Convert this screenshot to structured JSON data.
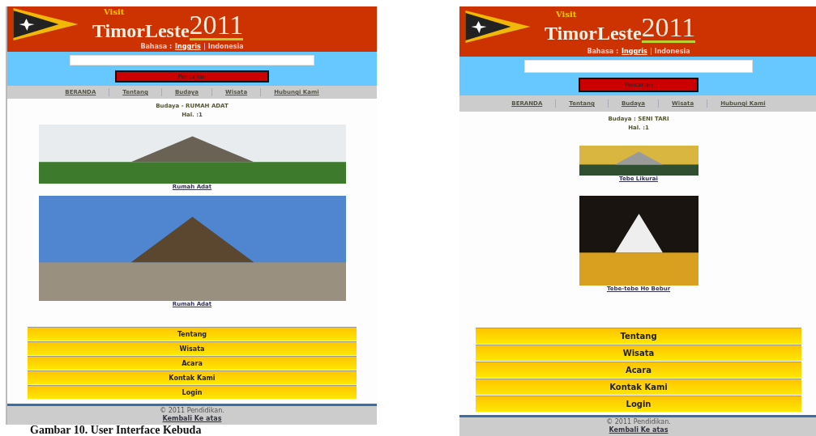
{
  "screens": [
    {
      "logo": {
        "small": "Visit",
        "name": "TimorLeste",
        "year": "2011"
      },
      "language_label": "Bahasa :",
      "languages": [
        {
          "label": "Inggris",
          "selected": false
        },
        {
          "label": "Indonesia",
          "selected": true
        }
      ],
      "search": {
        "button": "Pencarian"
      },
      "nav": [
        "BERANDA",
        "Tentang",
        "Budaya",
        "Wisata",
        "Hubungi Kami"
      ],
      "heading": "Budaya - RUMAH ADAT",
      "page": "Hal. :1",
      "photos": [
        {
          "caption": "Rumah Adat"
        },
        {
          "caption": "Rumah Adat"
        }
      ],
      "menu": [
        "Tentang",
        "Wisata",
        "Acara",
        "Kontak Kami",
        "Login"
      ],
      "footer": {
        "copyright": "© 2011 Pendidikan.",
        "link": "Kembali Ke atas"
      }
    },
    {
      "logo": {
        "small": "Visit",
        "name": "TimorLeste",
        "year": "2011"
      },
      "language_label": "Bahasa :",
      "languages": [
        {
          "label": "Inggris",
          "selected": false
        },
        {
          "label": "Indonesia",
          "selected": true
        }
      ],
      "search": {
        "button": "Pencarian"
      },
      "nav": [
        "BERANDA",
        "Tentang",
        "Budaya",
        "Wisata",
        "Hubungi Kami"
      ],
      "heading": "Budaya : SENI TARI",
      "page": "Hal. :1",
      "photos": [
        {
          "caption": "Tebe Likurai"
        },
        {
          "caption": "Tebe-tebe Ho Bebur"
        }
      ],
      "menu": [
        "Tentang",
        "Wisata",
        "Acara",
        "Kontak Kami",
        "Login"
      ],
      "footer": {
        "copyright": "© 2011 Pendidikan.",
        "link": "Kembali Ke atas"
      }
    }
  ],
  "caption": "Gambar 10. User Interface Kebuda"
}
